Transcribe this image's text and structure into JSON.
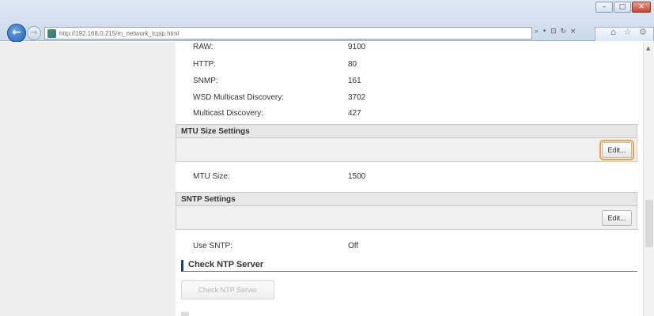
{
  "browser": {
    "url": "http://192.168.0.215/m_network_tcpip.html",
    "address_tools": "⌕ • ⊡ ↻ ×",
    "tab_icons": "⌂ ☆ ⚙",
    "window_controls": {
      "minimize": "–",
      "restore": "□",
      "close": "✕"
    }
  },
  "ports": [
    {
      "label": "RAW:",
      "value": "9100"
    },
    {
      "label": "HTTP:",
      "value": "80"
    },
    {
      "label": "SNMP:",
      "value": "161"
    },
    {
      "label": "WSD Multicast Discovery:",
      "value": "3702"
    },
    {
      "label": "Multicast Discovery:",
      "value": "427"
    }
  ],
  "mtu": {
    "header": "MTU Size Settings",
    "edit_label": "Edit...",
    "size_label": "MTU Size:",
    "size_value": "1500"
  },
  "sntp": {
    "header": "SNTP Settings",
    "edit_label": "Edit...",
    "use_label": "Use SNTP:",
    "use_value": "Off"
  },
  "check_ntp": {
    "title": "Check NTP Server",
    "button_label": "Check NTP Server"
  },
  "colors": {
    "highlight": "#f0a23a",
    "accent": "#1d3f7a"
  }
}
